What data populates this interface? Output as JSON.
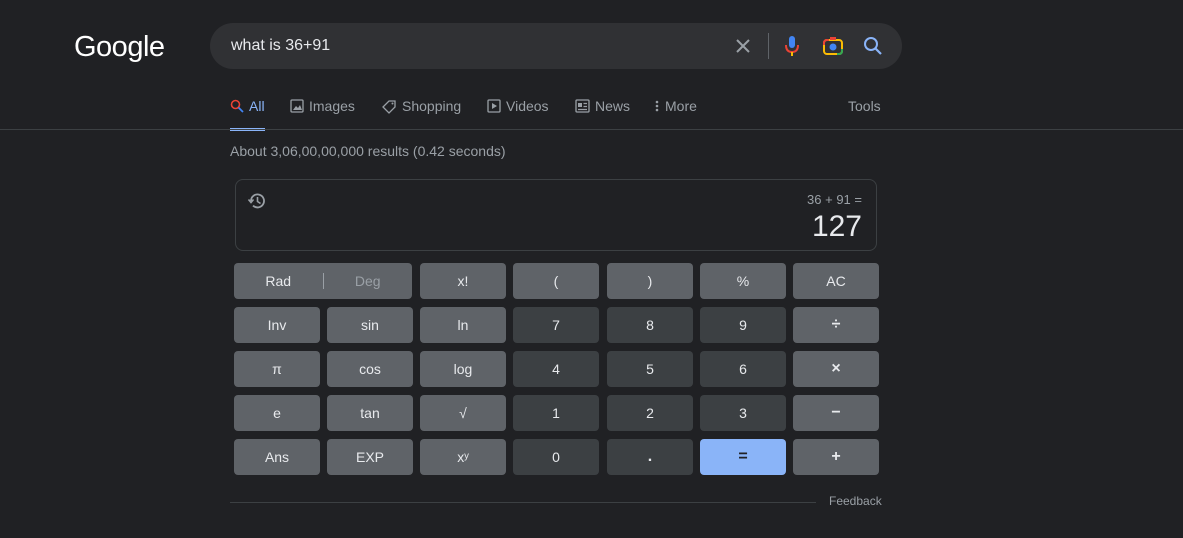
{
  "logo": "Google",
  "search": {
    "query": "what is 36+91"
  },
  "tabs": [
    {
      "label": "All",
      "active": true
    },
    {
      "label": "Images"
    },
    {
      "label": "Shopping"
    },
    {
      "label": "Videos"
    },
    {
      "label": "News"
    },
    {
      "label": "More"
    }
  ],
  "tools_label": "Tools",
  "stats": "About 3,06,00,00,000 results (0.42 seconds)",
  "calculator": {
    "expression": "36 + 91 =",
    "result": "127",
    "rad_label": "Rad",
    "deg_label": "Deg",
    "keys": {
      "fact": "x!",
      "lparen": "(",
      "rparen": ")",
      "percent": "%",
      "ac": "AC",
      "inv": "Inv",
      "sin": "sin",
      "ln": "ln",
      "k7": "7",
      "k8": "8",
      "k9": "9",
      "div": "÷",
      "pi": "π",
      "cos": "cos",
      "log": "log",
      "k4": "4",
      "k5": "5",
      "k6": "6",
      "mul": "×",
      "e": "e",
      "tan": "tan",
      "sqrt": "√",
      "k1": "1",
      "k2": "2",
      "k3": "3",
      "minus": "−",
      "ans": "Ans",
      "exp": "EXP",
      "pow": "xʸ",
      "k0": "0",
      "dot": ".",
      "eq": "=",
      "plus": "+"
    }
  },
  "feedback_label": "Feedback",
  "colors": {
    "accent": "#8ab4f8",
    "background": "#202124",
    "function_key": "#5f6368",
    "number_key": "#3c4043"
  }
}
